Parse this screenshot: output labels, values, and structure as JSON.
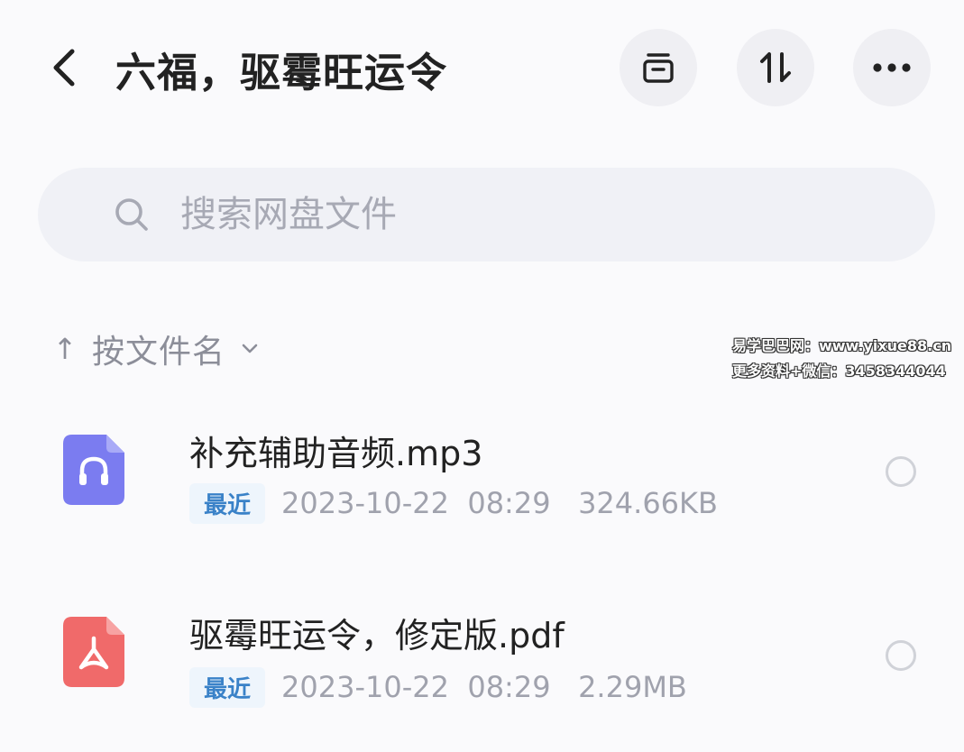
{
  "header": {
    "title": "六福，驱霉旺运令",
    "buttons": [
      "archive-icon",
      "sort-icon",
      "more-icon"
    ]
  },
  "search": {
    "placeholder": "搜索网盘文件"
  },
  "sort": {
    "label": "按文件名",
    "direction": "↑"
  },
  "watermark": {
    "line1": "易学巴巴网：www.yixue88.cn",
    "line2": "更多资料+微信：3458344044"
  },
  "files": [
    {
      "name": "补充辅助音频.mp3",
      "tag": "最近",
      "date": "2023-10-22",
      "time": "08:29",
      "size": "324.66KB",
      "icon": "audio-file-icon",
      "color": "#7b7cf0"
    },
    {
      "name": "驱霉旺运令，修定版.pdf",
      "tag": "最近",
      "date": "2023-10-22",
      "time": "08:29",
      "size": "2.29MB",
      "icon": "pdf-file-icon",
      "color": "#f06a6a"
    }
  ]
}
